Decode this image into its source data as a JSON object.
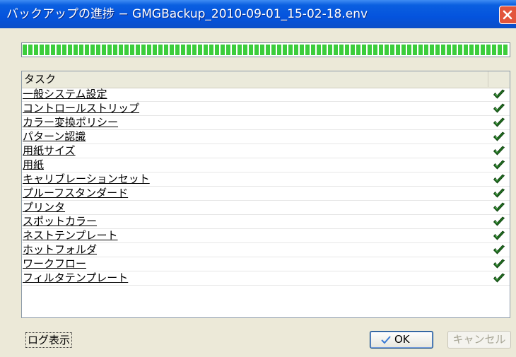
{
  "window": {
    "title": "バックアップの進捗 − GMGBackup_2010-09-01_15-02-18.env"
  },
  "progress": {
    "value_percent": 100,
    "fill_color": "#3ccd3c"
  },
  "task_list": {
    "header": {
      "task": "タスク"
    },
    "rows": [
      {
        "label": "一般システム設定",
        "status": "complete",
        "icon": "check-icon"
      },
      {
        "label": "コントロールストリップ",
        "status": "complete",
        "icon": "check-icon"
      },
      {
        "label": "カラー変換ポリシー",
        "status": "complete",
        "icon": "check-icon"
      },
      {
        "label": "パターン認識",
        "status": "complete",
        "icon": "check-icon"
      },
      {
        "label": "用紙サイズ",
        "status": "complete",
        "icon": "check-icon"
      },
      {
        "label": "用紙",
        "status": "complete",
        "icon": "check-icon"
      },
      {
        "label": "キャリブレーションセット",
        "status": "complete",
        "icon": "check-icon"
      },
      {
        "label": "プルーフスタンダード",
        "status": "complete",
        "icon": "check-icon"
      },
      {
        "label": "プリンタ",
        "status": "complete",
        "icon": "check-icon"
      },
      {
        "label": "スポットカラー",
        "status": "complete",
        "icon": "check-icon"
      },
      {
        "label": "ネストテンプレート",
        "status": "complete",
        "icon": "check-icon"
      },
      {
        "label": "ホットフォルダ",
        "status": "complete",
        "icon": "check-icon"
      },
      {
        "label": "ワークフロー",
        "status": "complete",
        "icon": "check-icon"
      },
      {
        "label": "フィルタテンプレート",
        "status": "complete",
        "icon": "check-icon"
      }
    ]
  },
  "buttons": {
    "log": "ログ表示",
    "ok": "OK",
    "cancel": "キャンセル"
  },
  "colors": {
    "titlebar": "#0453dd",
    "close": "#e2553c",
    "check": "#1f6b1f"
  }
}
